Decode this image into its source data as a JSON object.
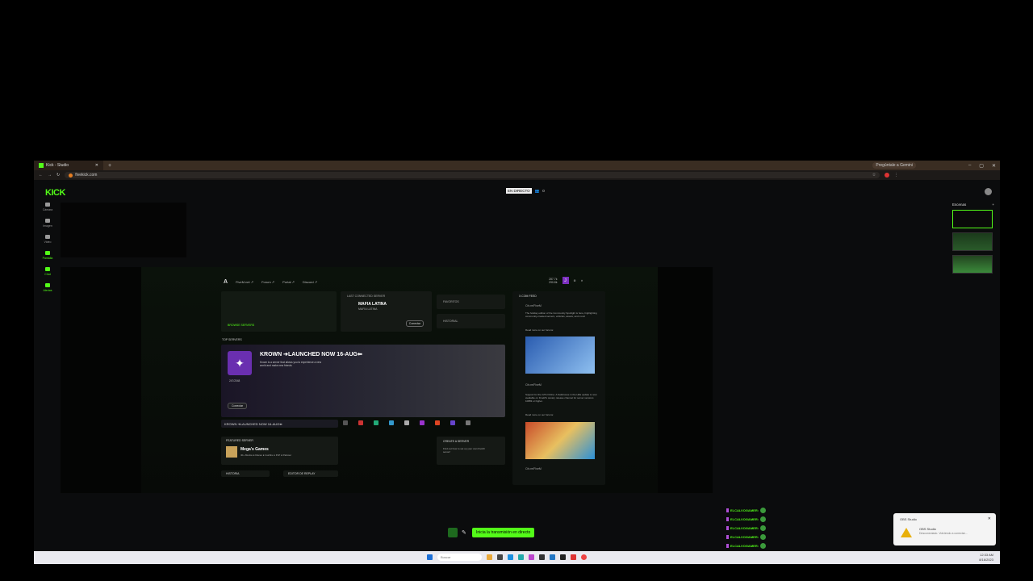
{
  "browser": {
    "tab_title": "Kick - Studio",
    "url": "fivekick.com",
    "gemini_label": "Pregúntale a Gemini"
  },
  "header": {
    "logo": "KICK",
    "badge": "EN DIRECTO",
    "viewers": "0"
  },
  "sidenav": [
    {
      "label": "Cámara"
    },
    {
      "label": "Imagen"
    },
    {
      "label": "Video"
    },
    {
      "label": "Pantalla"
    },
    {
      "label": "Chat"
    },
    {
      "label": "Alertas"
    }
  ],
  "fivem": {
    "logo": "A",
    "nav": [
      "FiveM.net ↗",
      "Forum ↗",
      "Portal ↗",
      "Discord ↗"
    ],
    "stats": "287.7k\n290.8k",
    "user_initial": "J",
    "browse_label": "BROWSE SERVERS",
    "last_connected_label": "LAST CONNECTED SERVER",
    "last_server_name": "MAFIA LATINA",
    "last_server_sub": "MAFIA LATINA",
    "last_connect_button": "Conectar",
    "favoritos": "FAVORITOS",
    "historial": "HISTORIAL",
    "feed_title": "X.COM FEED",
    "feed_handle_1": "Cfx.re/FiveM",
    "feed_text_1": "The holiday edition of the Community Spotlight is here, highlighting community-created servers, vehicles, assets, and more!",
    "feed_link_1": "Read more on our forums:",
    "feed_handle_2": "Cfx.re/FiveM",
    "feed_text_2": "Support for the GTA Online: A Safehouse in the Hills update is now available on FiveM's canary release channel for server versions 10883 or higher.",
    "feed_link_2": "Read more on our forums:",
    "feed_handle_3": "Cfx.re/FiveM",
    "top_servers_label": "TOP SERVERS",
    "krown_title": "KROWN ➔LAUNCHED NOW 16-AUG⬅",
    "krown_desc": "Krown is a server that allows you to experience a new world and make new friends",
    "krown_players": "247/2048",
    "krown_connect": "Conectar",
    "krown_bar": "KROWN ➔LAUNCHED NOW 16-AUG⬅",
    "featured_label": "FEATURED SERVER",
    "featured_name": "Mega's Games",
    "featured_tags": "40+ Modos ● Races ● Gunfire ● PvP ● Parkour",
    "create_label": "CREATE A SERVER",
    "create_desc": "Find out how to set up your own FiveM server!",
    "historia": "HISTORIA",
    "editor": "EDITOR DE REPLAY"
  },
  "scenes": {
    "label": "Escenas",
    "add": "+"
  },
  "chat": [
    "ELCALVOGAMER:",
    "ELCALVOGAMER:",
    "ELCALVOGAMER:",
    "ELCALVOGAMER:",
    "ELCALVOGAMER:"
  ],
  "golive": {
    "button": "Inicia la transmisión en directo"
  },
  "toast": {
    "app": "OBS Studio",
    "title": "OBS Studio",
    "msg": "Desconectado. Volviendo a conectar..."
  },
  "taskbar": {
    "search_placeholder": "Buscar",
    "time": "12:33 AM",
    "date": "8/16/2023"
  },
  "colors": {
    "kick_green": "#53fc18",
    "purple": "#7b2fbf"
  }
}
